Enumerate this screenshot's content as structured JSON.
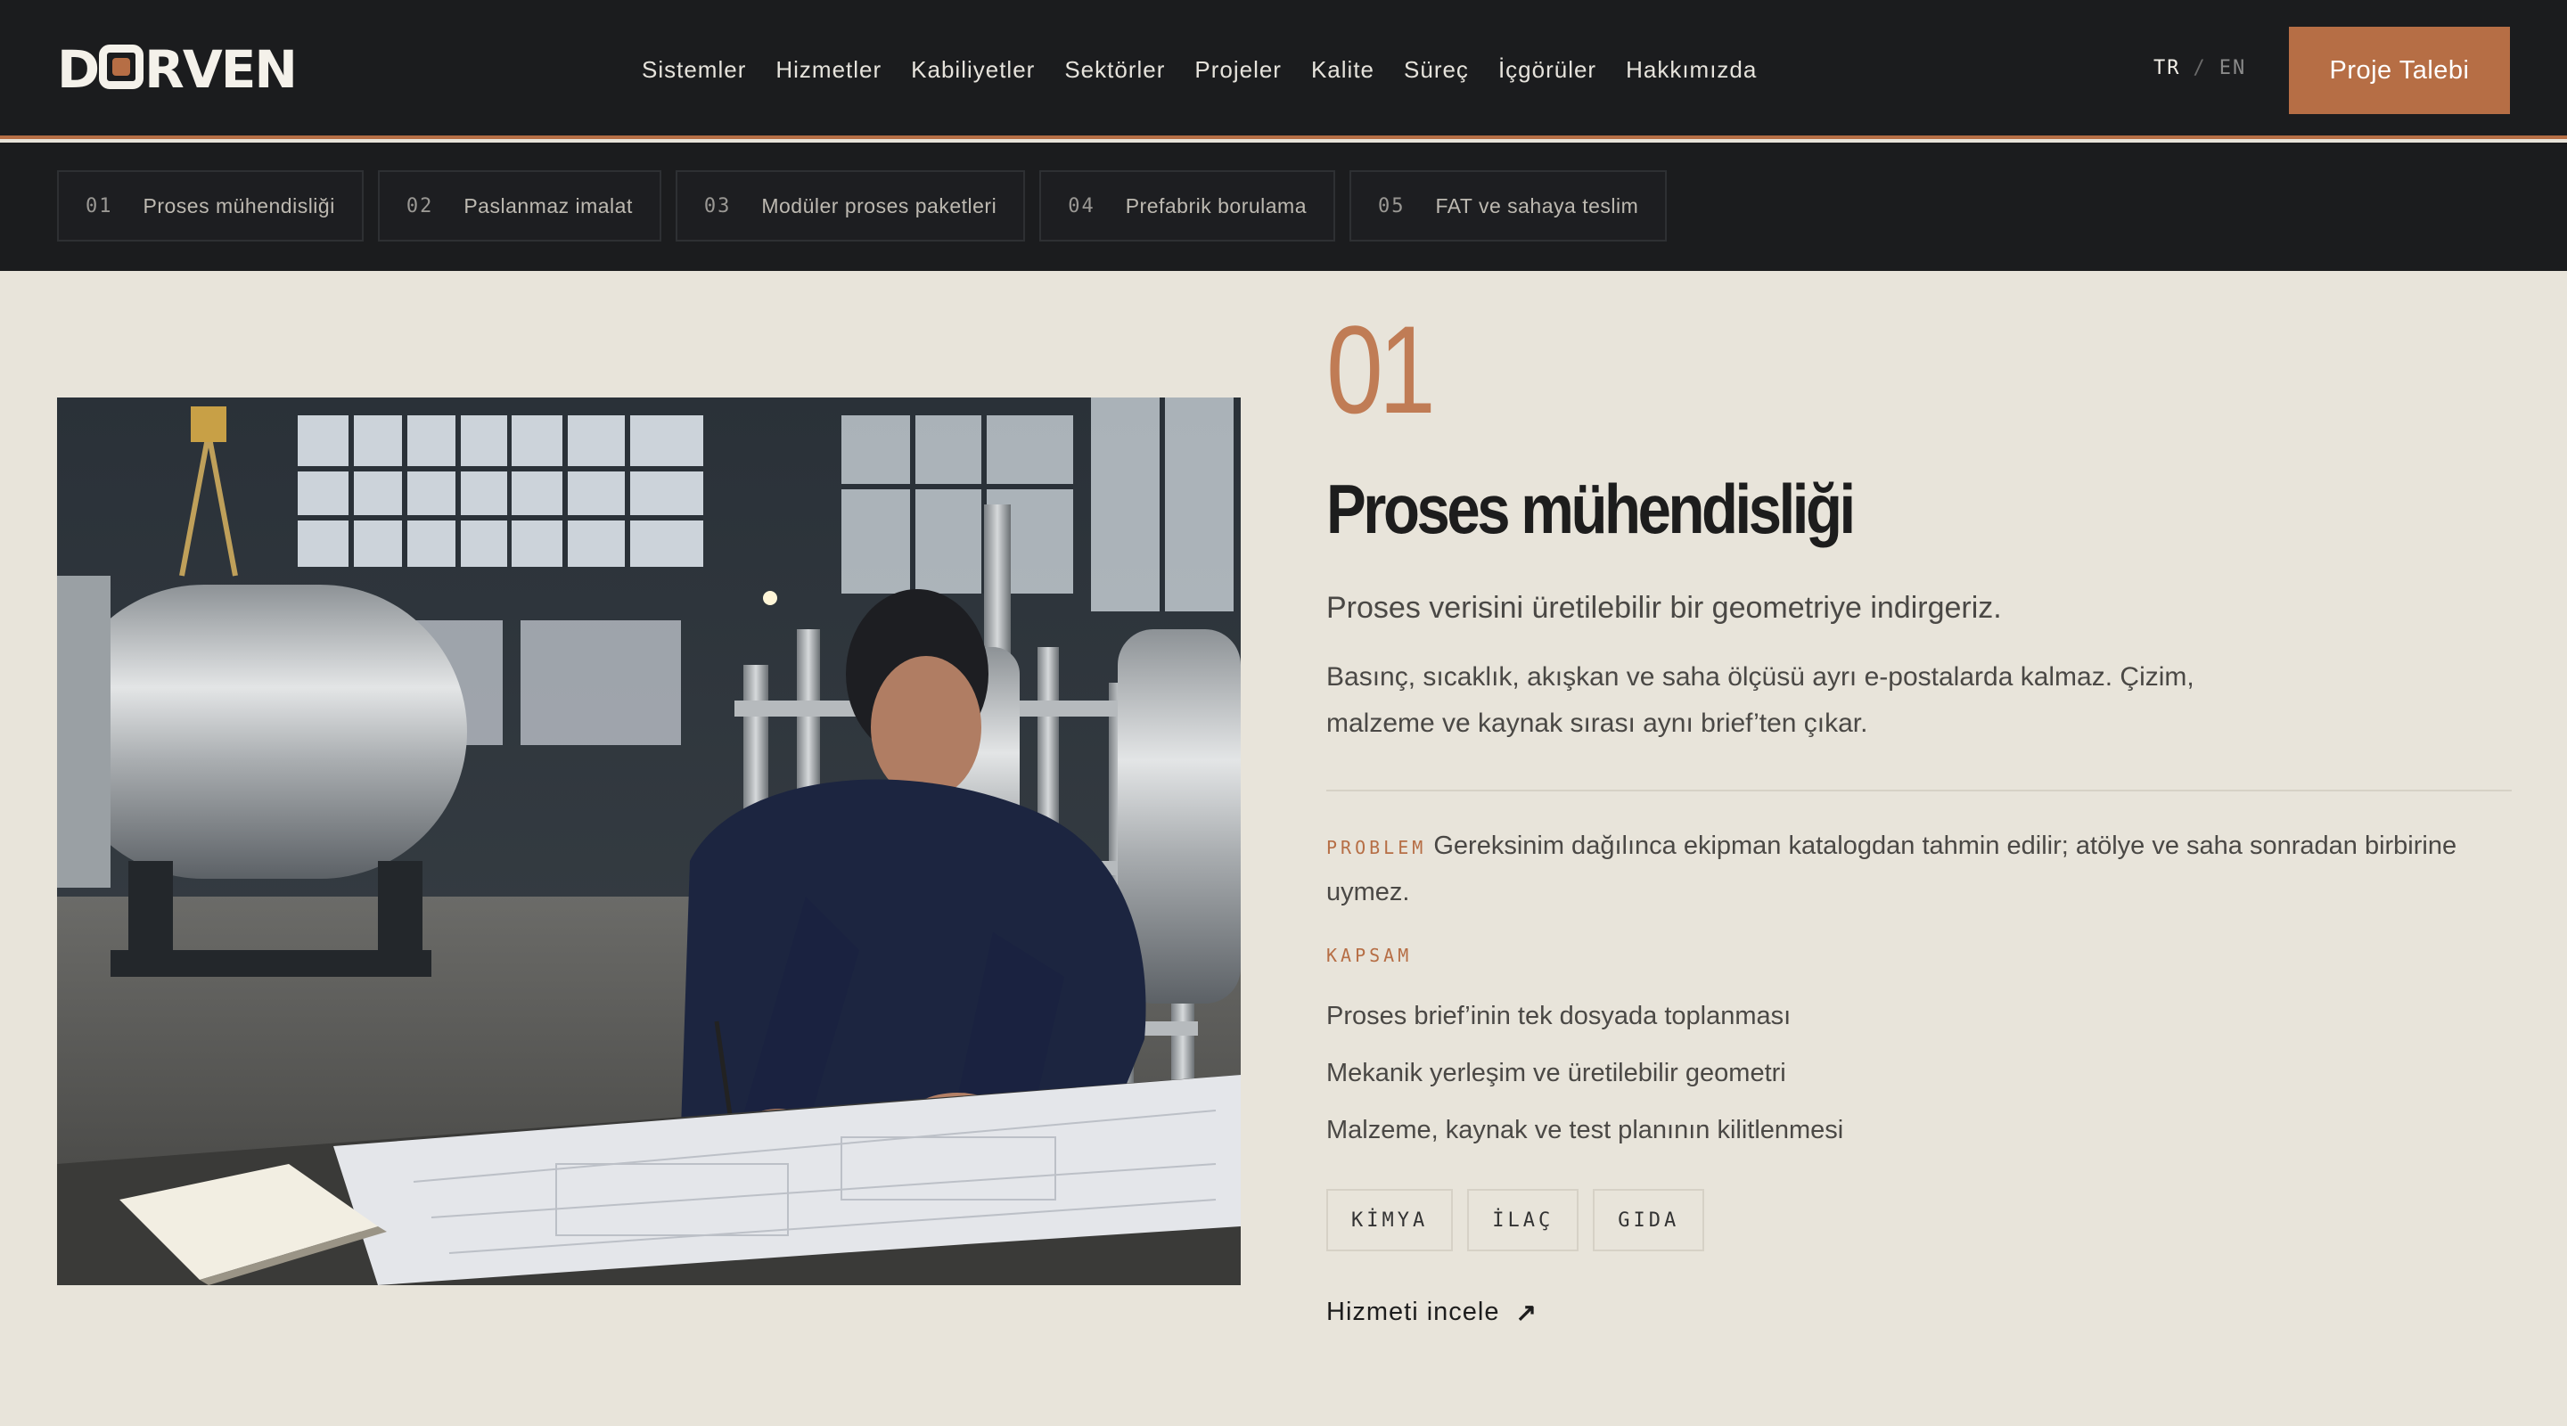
{
  "header": {
    "logo": "DORVEN",
    "nav": [
      "Sistemler",
      "Hizmetler",
      "Kabiliyetler",
      "Sektörler",
      "Projeler",
      "Kalite",
      "Süreç",
      "İçgörüler",
      "Hakkımızda"
    ],
    "lang_active": "TR",
    "lang_sep": "/",
    "lang_other": "EN",
    "cta_label": "Proje Talebi",
    "accent_color": "#b66e45"
  },
  "tabs": [
    {
      "num": "01",
      "label": "Proses mühendisliği"
    },
    {
      "num": "02",
      "label": "Paslanmaz imalat"
    },
    {
      "num": "03",
      "label": "Modüler proses paketleri"
    },
    {
      "num": "04",
      "label": "Prefabrik borulama"
    },
    {
      "num": "05",
      "label": "FAT ve sahaya teslim"
    }
  ],
  "service": {
    "number": "01",
    "title": "Proses mühendisliği",
    "lead": "Proses verisini üretilebilir bir geometriye indirgeriz.",
    "description": "Basınç, sıcaklık, akışkan ve saha ölçüsü ayrı e-postalarda kalmaz. Çizim, malzeme ve kaynak sırası aynı brief’ten çıkar.",
    "problem_label": "PROBLEM",
    "problem_text": "Gereksinim dağılınca ekipman katalogdan tahmin edilir; atölye ve saha sonradan birbirine uymez.",
    "scope_label": "KAPSAM",
    "scope_items": [
      "Proses brief’inin tek dosyada toplanması",
      "Mekanik yerleşim ve üretilebilir geometri",
      "Malzeme, kaynak ve test planının kilitlenmesi"
    ],
    "sectors": [
      "KİMYA",
      "İLAÇ",
      "GIDA"
    ],
    "link_label": "Hizmeti incele",
    "link_icon": "arrow-up-right-icon"
  }
}
